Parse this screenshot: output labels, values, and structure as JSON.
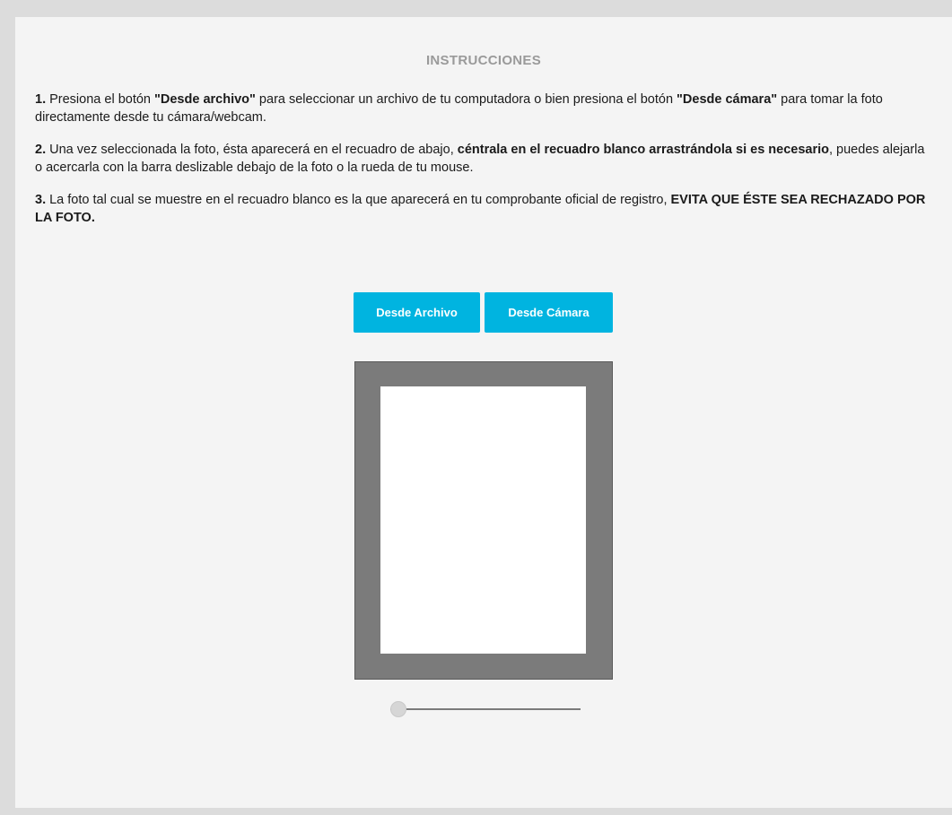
{
  "instructions": {
    "title": "INSTRUCCIONES",
    "step1": {
      "num": "1.",
      "t1": " Presiona el botón ",
      "b1": "\"Desde archivo\"",
      "t2": " para seleccionar un archivo de tu computadora o bien presiona el botón ",
      "b2": "\"Desde cámara\"",
      "t3": " para tomar la foto directamente desde tu cámara/webcam."
    },
    "step2": {
      "num": "2.",
      "t1": " Una vez seleccionada la foto, ésta aparecerá en el recuadro de abajo, ",
      "b1": "céntrala en el recuadro blanco arrastrándola si es necesario",
      "t2": ", puedes alejarla o acercarla con la barra deslizable debajo de la foto o la rueda de tu mouse."
    },
    "step3": {
      "num": "3.",
      "t1": " La foto tal cual se muestre en el recuadro blanco es la que aparecerá en tu comprobante oficial de registro, ",
      "b1": "EVITA QUE ÉSTE SEA RECHAZADO POR LA FOTO."
    }
  },
  "buttons": {
    "from_file": "Desde Archivo",
    "from_camera": "Desde Cámara"
  },
  "zoom_slider": {
    "value": 0
  },
  "colors": {
    "button_bg": "#00b4e0",
    "frame_bg": "#7b7b7b",
    "panel_bg": "#f4f4f4",
    "title": "#9a9a9a"
  }
}
